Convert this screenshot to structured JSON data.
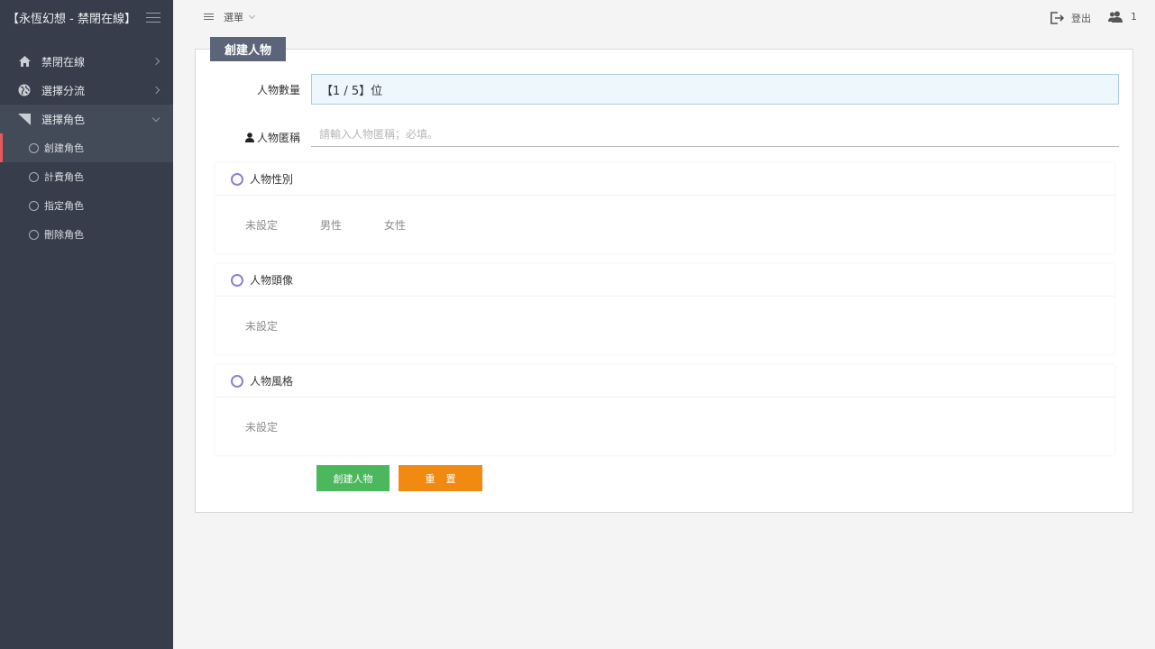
{
  "sidebar": {
    "brand": "【永恆幻想 - 禁閉在線】",
    "items": [
      {
        "label": "禁閉在線",
        "icon": "home-icon"
      },
      {
        "label": "選擇分流",
        "icon": "globe-icon"
      },
      {
        "label": "選擇角色",
        "icon": "corner-icon"
      }
    ],
    "subitems": [
      {
        "label": "創建角色"
      },
      {
        "label": "計費角色"
      },
      {
        "label": "指定角色"
      },
      {
        "label": "刪除角色"
      }
    ]
  },
  "topbar": {
    "menu_label": "選單",
    "logout_label": "登出",
    "user_count": "1"
  },
  "panel": {
    "tag": "創建人物",
    "count_label": "人物數量",
    "count_value": "【1 / 5】位",
    "name_label": "人物匿稱",
    "name_placeholder": "請輸入人物匿稱；必填。",
    "name_value": "",
    "sections": [
      {
        "title": "人物性別",
        "options": [
          "未設定",
          "男性",
          "女性"
        ]
      },
      {
        "title": "人物頭像",
        "options": [
          "未設定"
        ]
      },
      {
        "title": "人物風格",
        "options": [
          "未設定"
        ]
      }
    ],
    "create_button": "創建人物",
    "reset_button": "重置"
  },
  "colors": {
    "sidebar_bg": "#373d4a",
    "active_marker": "#e9585a",
    "tag_bg": "#5c6479",
    "create_btn": "#4cb85d",
    "reset_btn": "#f08a11",
    "ring": "#8f7dd6"
  }
}
